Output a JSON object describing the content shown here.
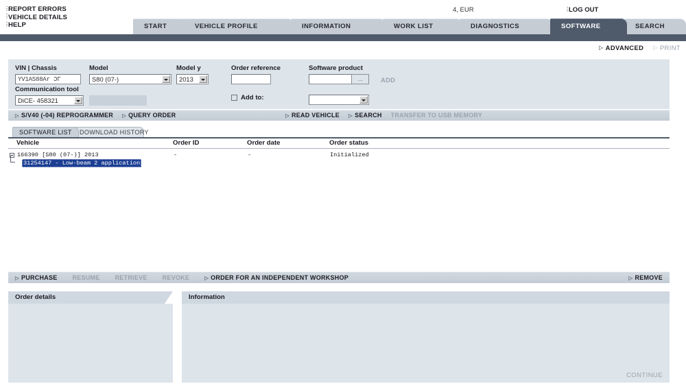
{
  "topbar": {
    "menu_items": [
      {
        "label": "REPORT ERRORS",
        "icon": "bullet-icon"
      },
      {
        "label": "VEHICLE DETAILS",
        "icon": "bullet-icon"
      },
      {
        "label": "HELP",
        "icon": "bullet-icon"
      }
    ],
    "currency": "4, EUR",
    "logout_label": "LOG OUT"
  },
  "tabs": [
    {
      "label": "START",
      "active": false
    },
    {
      "label": "VEHICLE PROFILE",
      "active": false
    },
    {
      "label": "INFORMATION",
      "active": false
    },
    {
      "label": "WORK LIST",
      "active": false
    },
    {
      "label": "DIAGNOSTICS",
      "active": false
    },
    {
      "label": "SOFTWARE",
      "active": true
    },
    {
      "label": "SEARCH",
      "active": false
    }
  ],
  "toolrow": {
    "advanced_label": "ADVANCED",
    "print_label": "PRINT"
  },
  "form": {
    "vin_label": "VIN | Chassis",
    "vin_value": "YV1AS88Ar ƆΓ",
    "model_label": "Model",
    "model_value": "S80 (07-)",
    "model_year_label": "Model y",
    "model_year_value": "2013",
    "order_reference_label": "Order reference",
    "order_reference_value": "",
    "software_product_label": "Software product",
    "software_product_value": "",
    "browse_label": "...",
    "add_label": "ADD",
    "communication_tool_label": "Communication tool",
    "communication_tool_value": "DiCE- 458321",
    "add_to_label": "Add to:",
    "add_to_checked": false,
    "add_to_value": ""
  },
  "actionbar": {
    "left": [
      {
        "label": "S/V40 (-04) REPROGRAMMER",
        "disabled": false
      },
      {
        "label": "QUERY ORDER",
        "disabled": false
      }
    ],
    "right": [
      {
        "label": "READ VEHICLE",
        "disabled": false
      },
      {
        "label": "SEARCH",
        "disabled": false
      },
      {
        "label": "TRANSFER TO USB MEMORY",
        "disabled": true
      }
    ]
  },
  "list_tabs": [
    {
      "label": "SOFTWARE LIST",
      "active": true
    },
    {
      "label": "DOWNLOAD HISTORY",
      "active": false
    }
  ],
  "table": {
    "columns": [
      "Vehicle",
      "Order ID",
      "Order date",
      "Order status"
    ],
    "rows": [
      {
        "vehicle": "166390  [S80 (07-)]   2013",
        "order_id": "-",
        "order_date": "-",
        "order_status": "Initialized"
      }
    ],
    "child_row": "31254147 - Low-beam 2 application"
  },
  "bottombar": {
    "left": [
      {
        "label": "PURCHASE",
        "disabled": false
      },
      {
        "label": "RESUME",
        "disabled": true
      },
      {
        "label": "RETRIEVE",
        "disabled": true
      },
      {
        "label": "REVOKE",
        "disabled": true
      },
      {
        "label": "ORDER FOR AN INDEPENDENT WORKSHOP",
        "disabled": false
      }
    ],
    "right": [
      {
        "label": "REMOVE",
        "disabled": false
      }
    ]
  },
  "panels": {
    "order_details_title": "Order details",
    "information_title": "Information",
    "continue_label": "CONTINUE"
  },
  "colors": {
    "tab_active_bg": "#4f5b6b",
    "tab_inactive_bg": "#c5ccd4",
    "panel_bg": "#dde4ea",
    "selection_bg": "#1c3f94",
    "bar_bg": "#c9d2da"
  }
}
